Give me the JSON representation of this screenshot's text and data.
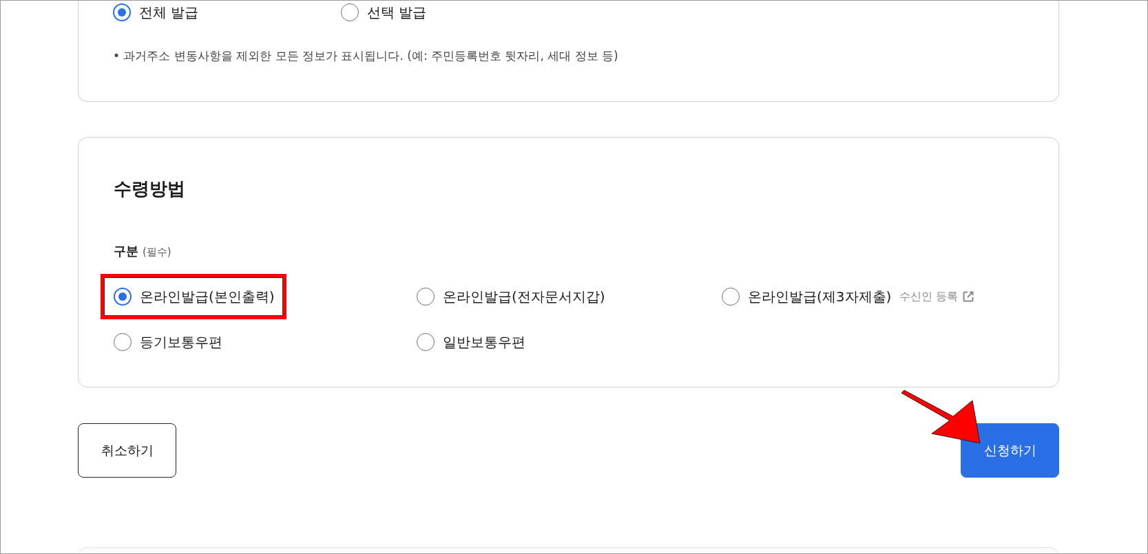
{
  "issue_scope": {
    "options": [
      {
        "label": "전체 발급",
        "selected": true
      },
      {
        "label": "선택 발급",
        "selected": false
      }
    ],
    "note": "• 과거주소 변동사항을 제외한 모든 정보가 표시됩니다. (예: 주민등록번호 뒷자리, 세대 정보 등)"
  },
  "receipt": {
    "title": "수령방법",
    "field_label": "구분",
    "field_hint": "(필수)",
    "options": [
      {
        "label": "온라인발급(본인출력)",
        "selected": true,
        "highlighted": true
      },
      {
        "label": "온라인발급(전자문서지갑)",
        "selected": false,
        "highlighted": false
      },
      {
        "label": "온라인발급(제3자제출)",
        "selected": false,
        "highlighted": false,
        "link": "수신인 등록"
      },
      {
        "label": "등기보통우편",
        "selected": false,
        "highlighted": false
      },
      {
        "label": "일반보통우편",
        "selected": false,
        "highlighted": false
      }
    ]
  },
  "buttons": [
    {
      "label": "취소하기",
      "kind": "secondary"
    },
    {
      "label": "신청하기",
      "kind": "primary"
    }
  ]
}
